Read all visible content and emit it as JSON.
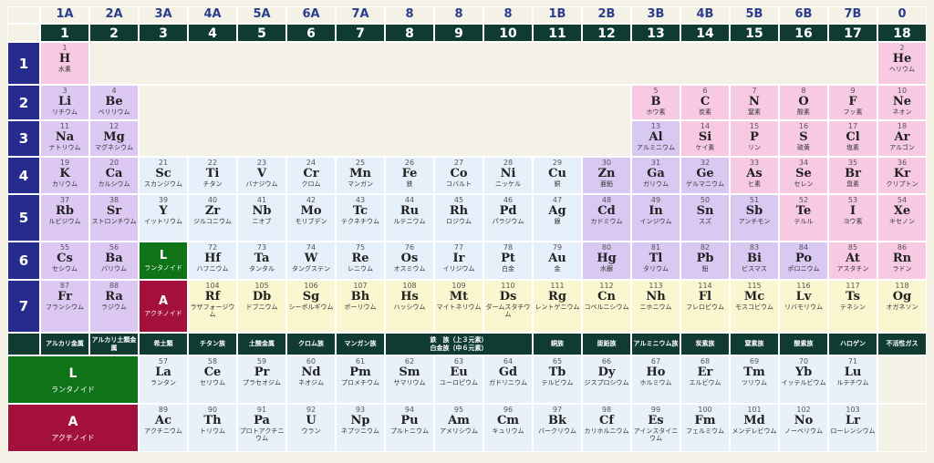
{
  "old_groups": [
    "1A",
    "2A",
    "3A",
    "4A",
    "5A",
    "6A",
    "7A",
    "8",
    "8",
    "8",
    "1B",
    "2B",
    "3B",
    "4B",
    "5B",
    "6B",
    "7B",
    "0"
  ],
  "new_groups": [
    "1",
    "2",
    "3",
    "4",
    "5",
    "6",
    "7",
    "8",
    "9",
    "10",
    "11",
    "12",
    "13",
    "14",
    "15",
    "16",
    "17",
    "18"
  ],
  "periods": [
    "1",
    "2",
    "3",
    "4",
    "5",
    "6",
    "7"
  ],
  "colors": {
    "s1": "#f8c9e3",
    "p_pink": "#f8c9e3",
    "s2": "#dcc8f3",
    "d": "#e6f0fa",
    "d_alt": "#d6e6f7",
    "zn_row": "#d8c8f2",
    "heavy": "#faf6cf",
    "lan_act": "#e8f1fa",
    "lan_spec": "#0f7317",
    "act_spec": "#a3103c"
  },
  "elements": [
    {
      "r": 1,
      "c": 1,
      "n": "1",
      "s": "H",
      "nm": "水素",
      "col": "s1"
    },
    {
      "r": 1,
      "c": 18,
      "n": "2",
      "s": "He",
      "nm": "ヘリウム",
      "col": "p_pink"
    },
    {
      "r": 2,
      "c": 1,
      "n": "3",
      "s": "Li",
      "nm": "リチウム",
      "col": "s2"
    },
    {
      "r": 2,
      "c": 2,
      "n": "4",
      "s": "Be",
      "nm": "ベリリウム",
      "col": "s2"
    },
    {
      "r": 2,
      "c": 13,
      "n": "5",
      "s": "B",
      "nm": "ホウ素",
      "col": "p_pink"
    },
    {
      "r": 2,
      "c": 14,
      "n": "6",
      "s": "C",
      "nm": "炭素",
      "col": "p_pink"
    },
    {
      "r": 2,
      "c": 15,
      "n": "7",
      "s": "N",
      "nm": "窒素",
      "col": "p_pink"
    },
    {
      "r": 2,
      "c": 16,
      "n": "8",
      "s": "O",
      "nm": "酸素",
      "col": "p_pink"
    },
    {
      "r": 2,
      "c": 17,
      "n": "9",
      "s": "F",
      "nm": "フッ素",
      "col": "p_pink"
    },
    {
      "r": 2,
      "c": 18,
      "n": "10",
      "s": "Ne",
      "nm": "ネオン",
      "col": "p_pink"
    },
    {
      "r": 3,
      "c": 1,
      "n": "11",
      "s": "Na",
      "nm": "ナトリウム",
      "col": "s2"
    },
    {
      "r": 3,
      "c": 2,
      "n": "12",
      "s": "Mg",
      "nm": "マグネシウム",
      "col": "s2"
    },
    {
      "r": 3,
      "c": 13,
      "n": "13",
      "s": "Al",
      "nm": "アルミニウム",
      "col": "zn_row"
    },
    {
      "r": 3,
      "c": 14,
      "n": "14",
      "s": "Si",
      "nm": "ケイ素",
      "col": "p_pink"
    },
    {
      "r": 3,
      "c": 15,
      "n": "15",
      "s": "P",
      "nm": "リン",
      "col": "p_pink"
    },
    {
      "r": 3,
      "c": 16,
      "n": "16",
      "s": "S",
      "nm": "硫黄",
      "col": "p_pink"
    },
    {
      "r": 3,
      "c": 17,
      "n": "17",
      "s": "Cl",
      "nm": "塩素",
      "col": "p_pink"
    },
    {
      "r": 3,
      "c": 18,
      "n": "18",
      "s": "Ar",
      "nm": "アルゴン",
      "col": "p_pink"
    },
    {
      "r": 4,
      "c": 1,
      "n": "19",
      "s": "K",
      "nm": "カリウム",
      "col": "s2"
    },
    {
      "r": 4,
      "c": 2,
      "n": "20",
      "s": "Ca",
      "nm": "カルシウム",
      "col": "s2"
    },
    {
      "r": 4,
      "c": 3,
      "n": "21",
      "s": "Sc",
      "nm": "スカンジウム",
      "col": "d"
    },
    {
      "r": 4,
      "c": 4,
      "n": "22",
      "s": "Ti",
      "nm": "チタン",
      "col": "d"
    },
    {
      "r": 4,
      "c": 5,
      "n": "23",
      "s": "V",
      "nm": "バナジウム",
      "col": "d"
    },
    {
      "r": 4,
      "c": 6,
      "n": "24",
      "s": "Cr",
      "nm": "クロム",
      "col": "d"
    },
    {
      "r": 4,
      "c": 7,
      "n": "25",
      "s": "Mn",
      "nm": "マンガン",
      "col": "d"
    },
    {
      "r": 4,
      "c": 8,
      "n": "26",
      "s": "Fe",
      "nm": "鉄",
      "col": "d"
    },
    {
      "r": 4,
      "c": 9,
      "n": "27",
      "s": "Co",
      "nm": "コバルト",
      "col": "d"
    },
    {
      "r": 4,
      "c": 10,
      "n": "28",
      "s": "Ni",
      "nm": "ニッケル",
      "col": "d"
    },
    {
      "r": 4,
      "c": 11,
      "n": "29",
      "s": "Cu",
      "nm": "銅",
      "col": "d"
    },
    {
      "r": 4,
      "c": 12,
      "n": "30",
      "s": "Zn",
      "nm": "亜鉛",
      "col": "zn_row"
    },
    {
      "r": 4,
      "c": 13,
      "n": "31",
      "s": "Ga",
      "nm": "ガリウム",
      "col": "zn_row"
    },
    {
      "r": 4,
      "c": 14,
      "n": "32",
      "s": "Ge",
      "nm": "ゲルマニウム",
      "col": "zn_row"
    },
    {
      "r": 4,
      "c": 15,
      "n": "33",
      "s": "As",
      "nm": "ヒ素",
      "col": "p_pink"
    },
    {
      "r": 4,
      "c": 16,
      "n": "34",
      "s": "Se",
      "nm": "セレン",
      "col": "p_pink"
    },
    {
      "r": 4,
      "c": 17,
      "n": "35",
      "s": "Br",
      "nm": "臭素",
      "col": "p_pink"
    },
    {
      "r": 4,
      "c": 18,
      "n": "36",
      "s": "Kr",
      "nm": "クリプトン",
      "col": "p_pink"
    },
    {
      "r": 5,
      "c": 1,
      "n": "37",
      "s": "Rb",
      "nm": "ルビジウム",
      "col": "s2"
    },
    {
      "r": 5,
      "c": 2,
      "n": "38",
      "s": "Sr",
      "nm": "ストロンチウム",
      "col": "s2"
    },
    {
      "r": 5,
      "c": 3,
      "n": "39",
      "s": "Y",
      "nm": "イットリウム",
      "col": "d"
    },
    {
      "r": 5,
      "c": 4,
      "n": "40",
      "s": "Zr",
      "nm": "ジルコニウム",
      "col": "d"
    },
    {
      "r": 5,
      "c": 5,
      "n": "41",
      "s": "Nb",
      "nm": "ニオブ",
      "col": "d"
    },
    {
      "r": 5,
      "c": 6,
      "n": "42",
      "s": "Mo",
      "nm": "モリブデン",
      "col": "d"
    },
    {
      "r": 5,
      "c": 7,
      "n": "43",
      "s": "Tc",
      "nm": "テクネチウム",
      "col": "d"
    },
    {
      "r": 5,
      "c": 8,
      "n": "44",
      "s": "Ru",
      "nm": "ルテニウム",
      "col": "d"
    },
    {
      "r": 5,
      "c": 9,
      "n": "45",
      "s": "Rh",
      "nm": "ロジウム",
      "col": "d"
    },
    {
      "r": 5,
      "c": 10,
      "n": "46",
      "s": "Pd",
      "nm": "パラジウム",
      "col": "d"
    },
    {
      "r": 5,
      "c": 11,
      "n": "47",
      "s": "Ag",
      "nm": "銀",
      "col": "d"
    },
    {
      "r": 5,
      "c": 12,
      "n": "48",
      "s": "Cd",
      "nm": "カドミウム",
      "col": "zn_row"
    },
    {
      "r": 5,
      "c": 13,
      "n": "49",
      "s": "In",
      "nm": "インジウム",
      "col": "zn_row"
    },
    {
      "r": 5,
      "c": 14,
      "n": "50",
      "s": "Sn",
      "nm": "スズ",
      "col": "zn_row"
    },
    {
      "r": 5,
      "c": 15,
      "n": "51",
      "s": "Sb",
      "nm": "アンチモン",
      "col": "zn_row"
    },
    {
      "r": 5,
      "c": 16,
      "n": "52",
      "s": "Te",
      "nm": "テルル",
      "col": "p_pink"
    },
    {
      "r": 5,
      "c": 17,
      "n": "53",
      "s": "I",
      "nm": "ヨウ素",
      "col": "p_pink"
    },
    {
      "r": 5,
      "c": 18,
      "n": "54",
      "s": "Xe",
      "nm": "キセノン",
      "col": "p_pink"
    },
    {
      "r": 6,
      "c": 1,
      "n": "55",
      "s": "Cs",
      "nm": "セシウム",
      "col": "s2"
    },
    {
      "r": 6,
      "c": 2,
      "n": "56",
      "s": "Ba",
      "nm": "バリウム",
      "col": "s2"
    },
    {
      "r": 6,
      "c": 4,
      "n": "72",
      "s": "Hf",
      "nm": "ハフニウム",
      "col": "d"
    },
    {
      "r": 6,
      "c": 5,
      "n": "73",
      "s": "Ta",
      "nm": "タンタル",
      "col": "d"
    },
    {
      "r": 6,
      "c": 6,
      "n": "74",
      "s": "W",
      "nm": "タングステン",
      "col": "d"
    },
    {
      "r": 6,
      "c": 7,
      "n": "75",
      "s": "Re",
      "nm": "レニウム",
      "col": "d"
    },
    {
      "r": 6,
      "c": 8,
      "n": "76",
      "s": "Os",
      "nm": "オスミウム",
      "col": "d"
    },
    {
      "r": 6,
      "c": 9,
      "n": "77",
      "s": "Ir",
      "nm": "イリジウム",
      "col": "d"
    },
    {
      "r": 6,
      "c": 10,
      "n": "78",
      "s": "Pt",
      "nm": "白金",
      "col": "d"
    },
    {
      "r": 6,
      "c": 11,
      "n": "79",
      "s": "Au",
      "nm": "金",
      "col": "d"
    },
    {
      "r": 6,
      "c": 12,
      "n": "80",
      "s": "Hg",
      "nm": "水銀",
      "col": "zn_row"
    },
    {
      "r": 6,
      "c": 13,
      "n": "81",
      "s": "Tl",
      "nm": "タリウム",
      "col": "zn_row"
    },
    {
      "r": 6,
      "c": 14,
      "n": "82",
      "s": "Pb",
      "nm": "鉛",
      "col": "zn_row"
    },
    {
      "r": 6,
      "c": 15,
      "n": "83",
      "s": "Bi",
      "nm": "ビスマス",
      "col": "zn_row"
    },
    {
      "r": 6,
      "c": 16,
      "n": "84",
      "s": "Po",
      "nm": "ポロニウム",
      "col": "zn_row"
    },
    {
      "r": 6,
      "c": 17,
      "n": "85",
      "s": "At",
      "nm": "アスタチン",
      "col": "p_pink"
    },
    {
      "r": 6,
      "c": 18,
      "n": "86",
      "s": "Rn",
      "nm": "ラドン",
      "col": "p_pink"
    },
    {
      "r": 7,
      "c": 1,
      "n": "87",
      "s": "Fr",
      "nm": "フランシウム",
      "col": "s2"
    },
    {
      "r": 7,
      "c": 2,
      "n": "88",
      "s": "Ra",
      "nm": "ラジウム",
      "col": "s2"
    },
    {
      "r": 7,
      "c": 4,
      "n": "104",
      "s": "Rf",
      "nm": "ラザフォージウム",
      "col": "heavy"
    },
    {
      "r": 7,
      "c": 5,
      "n": "105",
      "s": "Db",
      "nm": "ドブニウム",
      "col": "heavy"
    },
    {
      "r": 7,
      "c": 6,
      "n": "106",
      "s": "Sg",
      "nm": "シーボルギウム",
      "col": "heavy"
    },
    {
      "r": 7,
      "c": 7,
      "n": "107",
      "s": "Bh",
      "nm": "ボーリウム",
      "col": "heavy"
    },
    {
      "r": 7,
      "c": 8,
      "n": "108",
      "s": "Hs",
      "nm": "ハッシウム",
      "col": "heavy"
    },
    {
      "r": 7,
      "c": 9,
      "n": "109",
      "s": "Mt",
      "nm": "マイトネリウム",
      "col": "heavy"
    },
    {
      "r": 7,
      "c": 10,
      "n": "110",
      "s": "Ds",
      "nm": "ダームスタチウム",
      "col": "heavy"
    },
    {
      "r": 7,
      "c": 11,
      "n": "111",
      "s": "Rg",
      "nm": "レントゲニウム",
      "col": "heavy"
    },
    {
      "r": 7,
      "c": 12,
      "n": "112",
      "s": "Cn",
      "nm": "コペルニシウム",
      "col": "heavy"
    },
    {
      "r": 7,
      "c": 13,
      "n": "113",
      "s": "Nh",
      "nm": "ニホニウム",
      "col": "heavy"
    },
    {
      "r": 7,
      "c": 14,
      "n": "114",
      "s": "Fl",
      "nm": "フレロビウム",
      "col": "heavy"
    },
    {
      "r": 7,
      "c": 15,
      "n": "115",
      "s": "Mc",
      "nm": "モスコビウム",
      "col": "heavy"
    },
    {
      "r": 7,
      "c": 16,
      "n": "116",
      "s": "Lv",
      "nm": "リバモリウム",
      "col": "heavy"
    },
    {
      "r": 7,
      "c": 17,
      "n": "117",
      "s": "Ts",
      "nm": "テネシン",
      "col": "heavy"
    },
    {
      "r": 7,
      "c": 18,
      "n": "118",
      "s": "Og",
      "nm": "オガネソン",
      "col": "heavy"
    }
  ],
  "specials": {
    "lanthanoid": {
      "symbol": "L",
      "name": "ランタノイド"
    },
    "actinoid": {
      "symbol": "A",
      "name": "アクチノイド"
    }
  },
  "group_labels": [
    {
      "c1": 1,
      "c2": 1,
      "text": "アルカリ金属"
    },
    {
      "c1": 2,
      "c2": 2,
      "text": "アルカリ土類金属"
    },
    {
      "c1": 3,
      "c2": 3,
      "text": "希土類"
    },
    {
      "c1": 4,
      "c2": 4,
      "text": "チタン族"
    },
    {
      "c1": 5,
      "c2": 5,
      "text": "土酸金属"
    },
    {
      "c1": 6,
      "c2": 6,
      "text": "クロム族"
    },
    {
      "c1": 7,
      "c2": 7,
      "text": "マンガン族"
    },
    {
      "c1": 8,
      "c2": 10,
      "text": "鉄　族（上３元素）\n白金族（中６元素）"
    },
    {
      "c1": 11,
      "c2": 11,
      "text": "銅族"
    },
    {
      "c1": 12,
      "c2": 12,
      "text": "亜鉛族"
    },
    {
      "c1": 13,
      "c2": 13,
      "text": "アルミニウム族"
    },
    {
      "c1": 14,
      "c2": 14,
      "text": "炭素族"
    },
    {
      "c1": 15,
      "c2": 15,
      "text": "窒素族"
    },
    {
      "c1": 16,
      "c2": 16,
      "text": "酸素族"
    },
    {
      "c1": 17,
      "c2": 17,
      "text": "ハロゲン"
    },
    {
      "c1": 18,
      "c2": 18,
      "text": "不活性ガス"
    }
  ],
  "lanthanides": [
    {
      "n": "57",
      "s": "La",
      "nm": "ランタン"
    },
    {
      "n": "58",
      "s": "Ce",
      "nm": "セリウム"
    },
    {
      "n": "59",
      "s": "Pr",
      "nm": "プラセオジム"
    },
    {
      "n": "60",
      "s": "Nd",
      "nm": "ネオジム"
    },
    {
      "n": "61",
      "s": "Pm",
      "nm": "プロメチウム"
    },
    {
      "n": "62",
      "s": "Sm",
      "nm": "サマリウム"
    },
    {
      "n": "63",
      "s": "Eu",
      "nm": "ユーロピウム"
    },
    {
      "n": "64",
      "s": "Gd",
      "nm": "ガドリニウム"
    },
    {
      "n": "65",
      "s": "Tb",
      "nm": "テルビウム"
    },
    {
      "n": "66",
      "s": "Dy",
      "nm": "ジスプロシウム"
    },
    {
      "n": "67",
      "s": "Ho",
      "nm": "ホルミウム"
    },
    {
      "n": "68",
      "s": "Er",
      "nm": "エルビウム"
    },
    {
      "n": "69",
      "s": "Tm",
      "nm": "ツリウム"
    },
    {
      "n": "70",
      "s": "Yb",
      "nm": "イッテルビウム"
    },
    {
      "n": "71",
      "s": "Lu",
      "nm": "ルテチウム"
    }
  ],
  "actinides": [
    {
      "n": "89",
      "s": "Ac",
      "nm": "アクチニウム"
    },
    {
      "n": "90",
      "s": "Th",
      "nm": "トリウム"
    },
    {
      "n": "91",
      "s": "Pa",
      "nm": "プロトアクチニウム"
    },
    {
      "n": "92",
      "s": "U",
      "nm": "ウラン"
    },
    {
      "n": "93",
      "s": "Np",
      "nm": "ネプツニウム"
    },
    {
      "n": "94",
      "s": "Pu",
      "nm": "プルトニウム"
    },
    {
      "n": "95",
      "s": "Am",
      "nm": "アメリシウム"
    },
    {
      "n": "96",
      "s": "Cm",
      "nm": "キュリウム"
    },
    {
      "n": "97",
      "s": "Bk",
      "nm": "バークリウム"
    },
    {
      "n": "98",
      "s": "Cf",
      "nm": "カリホルニウム"
    },
    {
      "n": "99",
      "s": "Es",
      "nm": "アインスタイニウム"
    },
    {
      "n": "100",
      "s": "Fm",
      "nm": "フェルミウム"
    },
    {
      "n": "101",
      "s": "Md",
      "nm": "メンデレビウム"
    },
    {
      "n": "102",
      "s": "No",
      "nm": "ノーベリウム"
    },
    {
      "n": "103",
      "s": "Lr",
      "nm": "ローレンシウム"
    }
  ]
}
